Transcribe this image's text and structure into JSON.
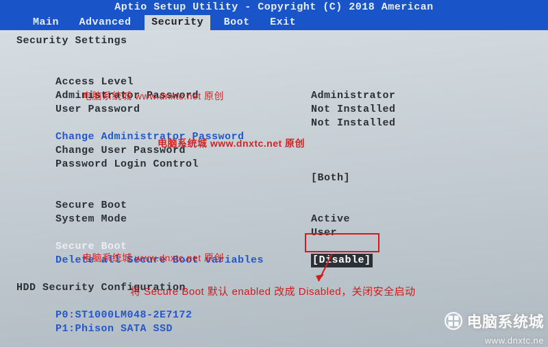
{
  "titlebar": "Aptio Setup Utility - Copyright (C) 2018 American",
  "menu": {
    "items": [
      "Main",
      "Advanced",
      "Security",
      "Boot",
      "Exit"
    ],
    "selected_index": 2
  },
  "header": "Security Settings",
  "status_rows": [
    {
      "label": "Access Level",
      "value": "Administrator"
    },
    {
      "label": "Administrator Password",
      "value": "Not Installed"
    },
    {
      "label": "User Password",
      "value": "Not Installed"
    }
  ],
  "action_rows": [
    {
      "label": "Change Administrator Password",
      "value": "",
      "blue": true,
      "interact": true
    },
    {
      "label": "Change User Password",
      "value": "",
      "blue": false,
      "interact": true
    },
    {
      "label": "Password Login Control",
      "value": "[Both]",
      "blue": false,
      "interact": true
    }
  ],
  "secure_rows": [
    {
      "label": "Secure Boot",
      "value": "Active"
    },
    {
      "label": "System Mode",
      "value": "User"
    }
  ],
  "secure_boot_setting": {
    "label": "Secure Boot",
    "value": "[Disable]"
  },
  "delete_secure": "Delete all Secure Boot variables",
  "hdd_header": "HDD Security Configuration",
  "hdd_items": [
    "P0:ST1000LM048-2E7172",
    "P1:Phison SATA SSD"
  ],
  "annotation_caption": "将 Secure Boot 默认 enabled 改成 Disabled，关闭安全启动",
  "watermarks": {
    "w1": "电脑系统城 www.dnxtc.net 原创",
    "w2": "电脑系统城 www.dnxtc.net 原创",
    "w3": "电脑系统城 www.dnxtc.net 原创"
  },
  "brand_text": "电脑系统城",
  "brand_url": "www.dnxtc.ne"
}
